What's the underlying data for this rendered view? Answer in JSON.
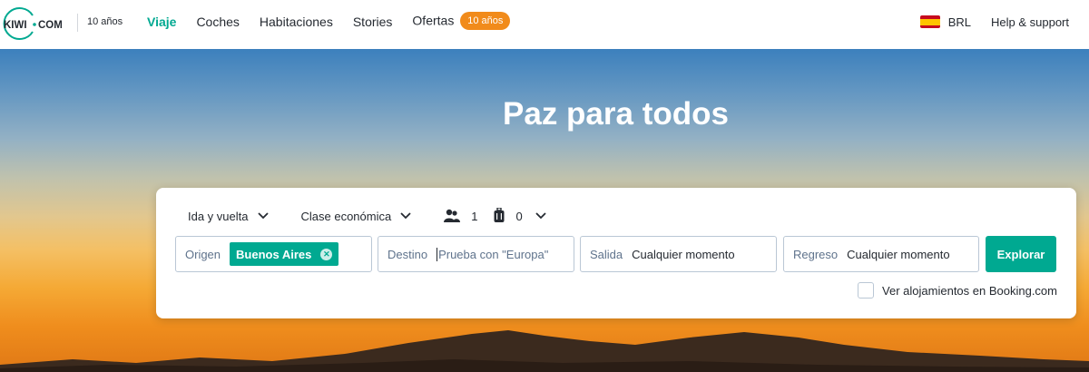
{
  "header": {
    "logo_text": "KIWI·COM",
    "anniversary": "10 años",
    "nav": [
      {
        "label": "Viaje",
        "active": true
      },
      {
        "label": "Coches",
        "active": false
      },
      {
        "label": "Habitaciones",
        "active": false
      },
      {
        "label": "Stories",
        "active": false
      },
      {
        "label": "Ofertas",
        "active": false,
        "badge": "10 años"
      }
    ],
    "currency": "BRL",
    "currency_icon": "spain-flag-icon",
    "help": "Help & support"
  },
  "hero": {
    "title": "Paz para todos"
  },
  "search": {
    "trip_type": "Ida y vuelta",
    "cabin_class": "Clase económica",
    "passengers": "1",
    "bags": "0",
    "origin": {
      "label": "Origen",
      "chip": "Buenos Aires"
    },
    "destination": {
      "label": "Destino",
      "placeholder": "Prueba con \"Europa\""
    },
    "departure": {
      "label": "Salida",
      "value": "Cualquier momento"
    },
    "return": {
      "label": "Regreso",
      "value": "Cualquier momento"
    },
    "explore_button": "Explorar",
    "booking_checkbox": "Ver alojamientos en Booking.com"
  },
  "colors": {
    "accent": "#00a991",
    "badge": "#f18b1b",
    "text": "#252a31",
    "muted": "#5f738c"
  }
}
